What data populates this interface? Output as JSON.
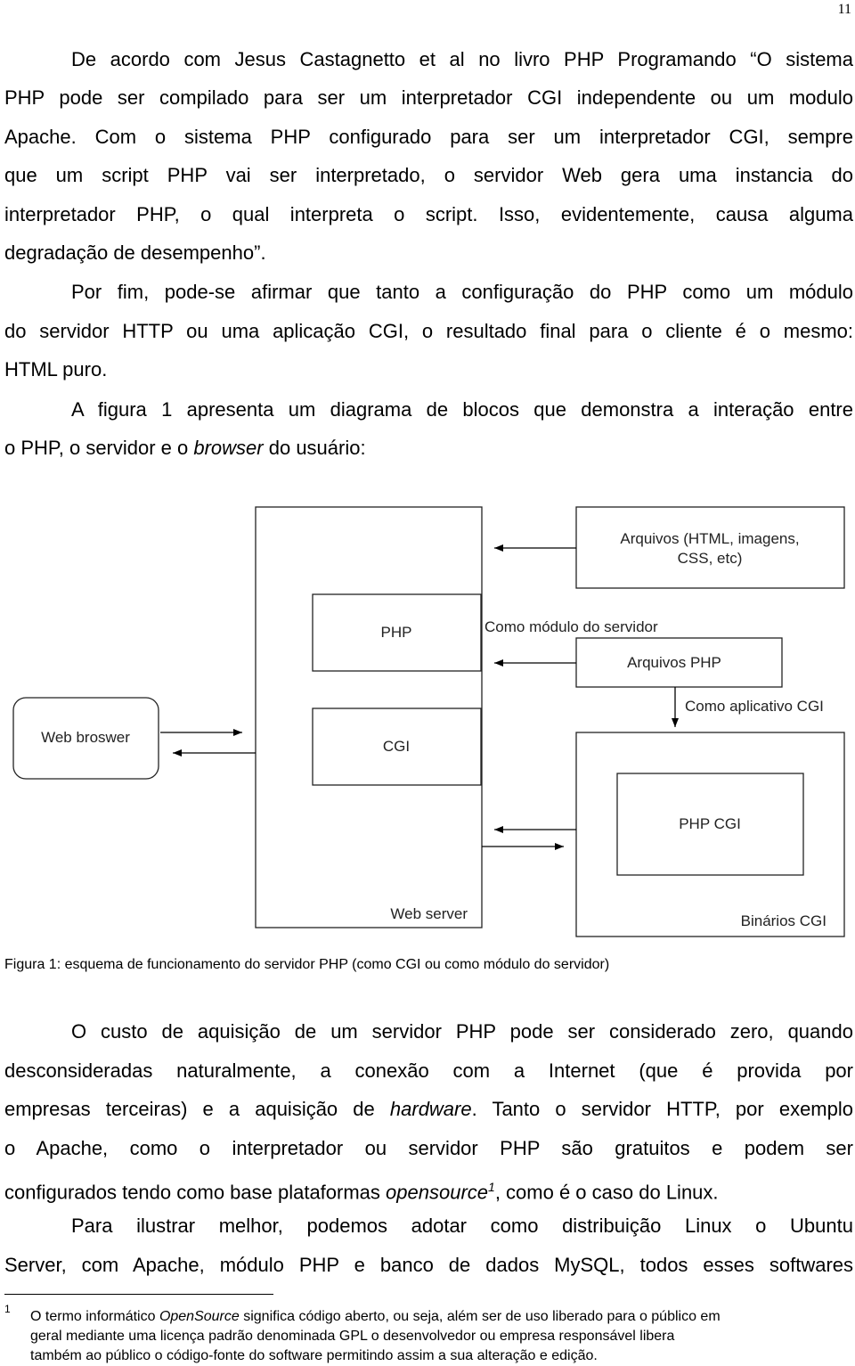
{
  "page_number": "11",
  "paragraphs": [
    {
      "lines": [
        "De acordo com Jesus Castagnetto et al no livro PHP Programando “O sistema",
        "PHP pode ser compilado para ser um interpretador CGI independente ou um modulo",
        "Apache. Com o sistema PHP configurado para ser um interpretador CGI, sempre",
        "que um script PHP vai ser interpretado, o servidor Web gera uma instancia do",
        "interpretador PHP, o qual interpreta o script. Isso, evidentemente, causa alguma",
        "degradação de desempenho”."
      ]
    },
    {
      "lines": [
        "Por fim, pode-se afirmar que tanto a configuração do PHP como um módulo",
        "do servidor HTTP ou uma aplicação CGI, o resultado final para o cliente é o mesmo:",
        "HTML puro."
      ]
    },
    {
      "lines": [
        "A figura 1 apresenta um diagrama de blocos que demonstra a interação entre",
        {
          "pre": "o PHP, o servidor e o ",
          "em": "browser",
          "post": " do usuário:"
        }
      ]
    },
    {
      "lines": [
        "O custo de aquisição de um servidor PHP pode ser considerado zero, quando",
        "desconsideradas naturalmente, a conexão com a Internet (que é provida por",
        {
          "pre": "empresas terceiras) e a aquisição de ",
          "em": "hardware",
          "post": ". Tanto o servidor HTTP, por exemplo"
        },
        "o Apache, como o interpretador ou servidor PHP são gratuitos e podem ser",
        {
          "pre": "configurados tendo como base plataformas ",
          "em": "opensource",
          "sup": "1",
          "post": ", como é o caso do Linux."
        }
      ]
    },
    {
      "lines": [
        "Para ilustrar melhor, podemos adotar como distribuição Linux o Ubuntu",
        "Server, com Apache, módulo PHP e banco de dados MySQL, todos esses softwares"
      ]
    }
  ],
  "figure": {
    "web_server": "Web server",
    "php": "PHP",
    "cgi": "CGI",
    "web_browser": "Web broswer",
    "arquivos_line1": "Arquivos (HTML, imagens,",
    "arquivos_line2": "CSS, etc)",
    "como_modulo": "Como módulo do servidor",
    "arquivos_php": "Arquivos PHP",
    "como_aplicativo": "Como aplicativo CGI",
    "php_cgi": "PHP CGI",
    "binarios_cgi": "Binários CGI",
    "caption": "Figura 1: esquema de funcionamento do servidor PHP (como CGI ou como módulo do servidor)"
  },
  "footnote": {
    "mark": "1",
    "line1_pre": "O termo informático ",
    "line1_em": "OpenSource",
    "line1_post": " significa código aberto, ou seja, além ser de uso liberado para o público em",
    "line2": "geral mediante uma licença padrão denominada GPL o desenvolvedor ou empresa responsável libera",
    "line3": "também ao público o código-fonte do software permitindo assim a sua alteração e edição."
  }
}
